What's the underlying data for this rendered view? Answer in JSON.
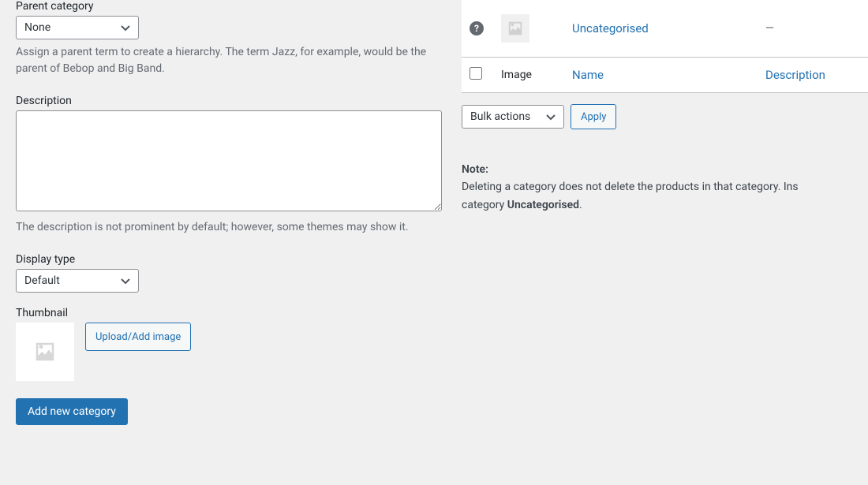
{
  "form": {
    "parent": {
      "label": "Parent category",
      "selected": "None",
      "help": "Assign a parent term to create a hierarchy. The term Jazz, for example, would be the parent of Bebop and Big Band."
    },
    "description": {
      "label": "Description",
      "value": "",
      "help": "The description is not prominent by default; however, some themes may show it."
    },
    "display_type": {
      "label": "Display type",
      "selected": "Default"
    },
    "thumbnail": {
      "label": "Thumbnail",
      "upload_label": "Upload/Add image"
    },
    "submit_label": "Add new category"
  },
  "table": {
    "rows": [
      {
        "name": "Uncategorised",
        "description": "—"
      }
    ],
    "columns": {
      "image": "Image",
      "name": "Name",
      "description": "Description"
    }
  },
  "bulk": {
    "select_label": "Bulk actions",
    "apply_label": "Apply"
  },
  "note": {
    "title": "Note:",
    "body_prefix": "Deleting a category does not delete the products in that category. Ins",
    "body_mid": "category ",
    "default_cat": "Uncategorised",
    "body_suffix": "."
  }
}
